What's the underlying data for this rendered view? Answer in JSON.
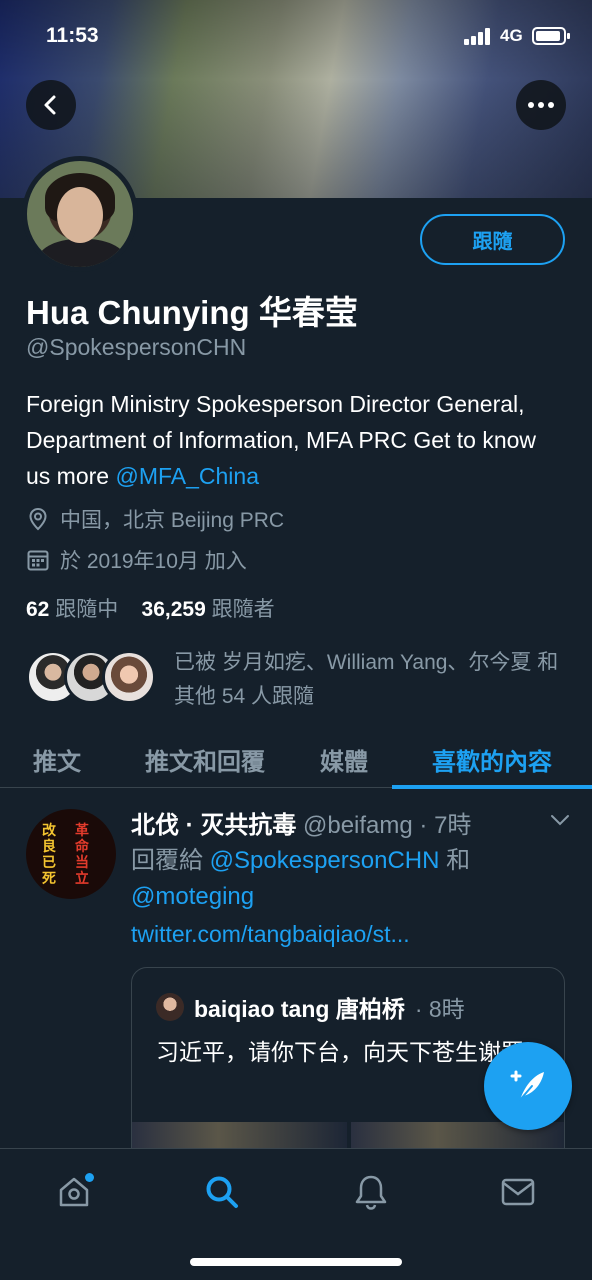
{
  "status_bar": {
    "time": "11:53",
    "network": "4G"
  },
  "header": {
    "back_icon": "back-arrow-icon",
    "more_icon": "more-icon"
  },
  "profile": {
    "display_name": "Hua Chunying 华春莹",
    "handle": "@SpokespersonCHN",
    "follow_label": "跟隨",
    "bio_text": "Foreign Ministry Spokesperson Director General, Department of Information, MFA PRC Get to know us more ",
    "bio_link": "@MFA_China",
    "location": "中国，北京 Beijing PRC",
    "joined": "於 2019年10月 加入",
    "following_count": "62",
    "following_label": "跟隨中",
    "followers_count": "36,259",
    "followers_label": "跟隨者",
    "followed_by": "已被 岁月如疙、William Yang、尔今夏 和其他 54 人跟隨"
  },
  "tabs": [
    {
      "label": "推文"
    },
    {
      "label": "推文和回覆"
    },
    {
      "label": "媒體"
    },
    {
      "label": "喜歡的內容",
      "active": true
    }
  ],
  "tweet": {
    "avatar_text_left": "改良已死",
    "avatar_text_right": "革命当立",
    "name": "北伐 · 灭共抗毒",
    "handle_time": "@beifamg · 7時",
    "reply_prefix": "回覆給 ",
    "reply_to_1": "@SpokespersonCHN",
    "reply_and": " 和",
    "reply_to_2": "@moteging",
    "link": "twitter.com/tangbaiqiao/st...",
    "quote": {
      "name": "baiqiao tang 唐柏桥",
      "time": "· 8時",
      "text": "习近平，请你下台，向天下苍生谢罪！"
    }
  },
  "nav": [
    {
      "icon": "home-icon"
    },
    {
      "icon": "search-icon",
      "active": true
    },
    {
      "icon": "notifications-icon"
    },
    {
      "icon": "messages-icon"
    }
  ],
  "colors": {
    "accent": "#1da1f2",
    "background": "#15202b",
    "secondary_text": "#8899a6",
    "divider": "#38444d"
  }
}
